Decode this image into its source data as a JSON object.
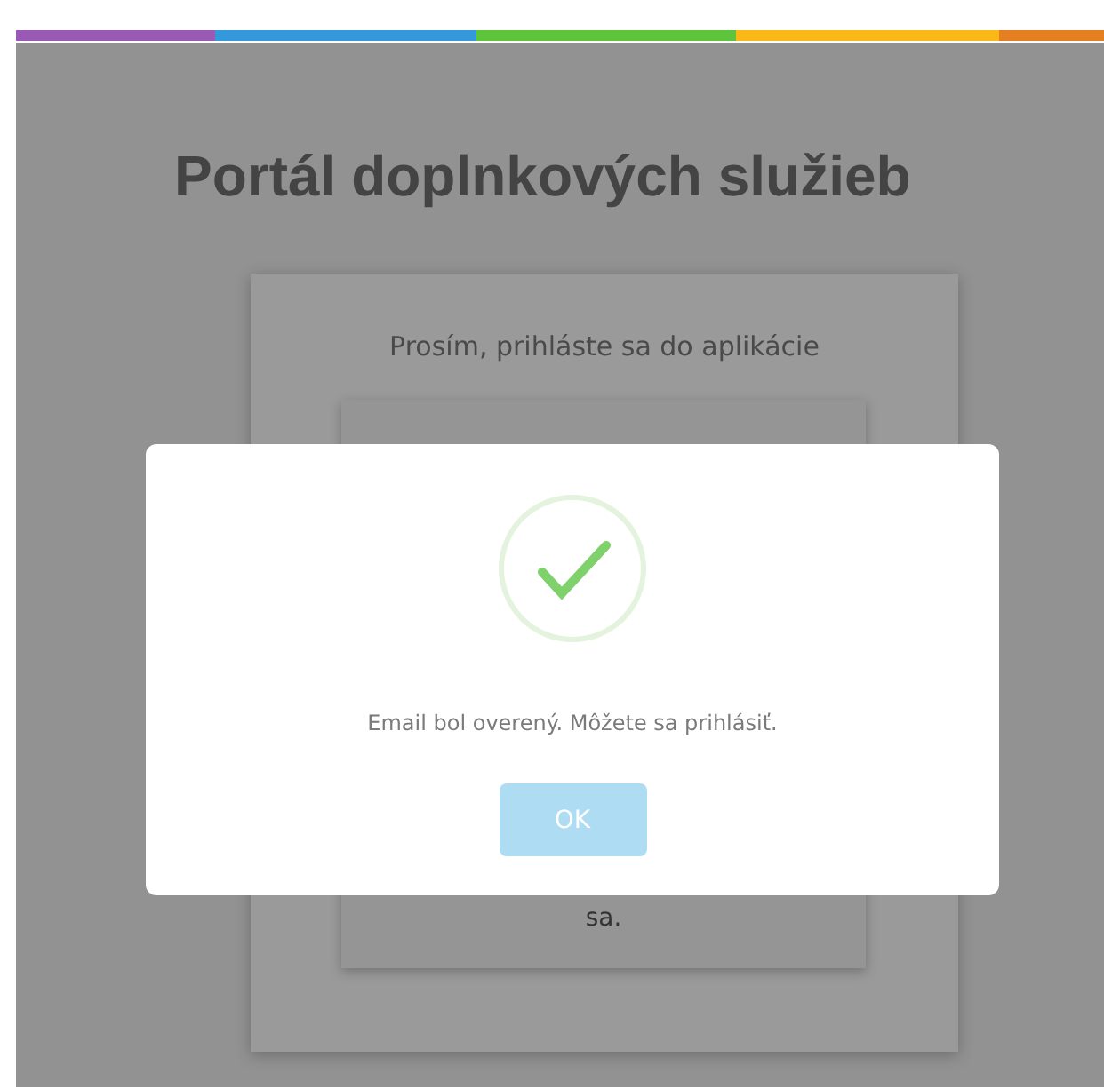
{
  "accent_stripe": [
    {
      "color": "#9b59b6"
    },
    {
      "color": "#3498db"
    },
    {
      "color": "#5ec43a"
    },
    {
      "color": "#fbb917"
    },
    {
      "color": "#e67e22"
    }
  ],
  "page_title": "Portál doplnkových služieb",
  "login_card": {
    "heading": "Prosím, prihláste sa do aplikácie",
    "inner_panel_text": "sa."
  },
  "dialog": {
    "message": "Email bol overený. Môžete sa prihlásiť.",
    "button": "OK"
  }
}
